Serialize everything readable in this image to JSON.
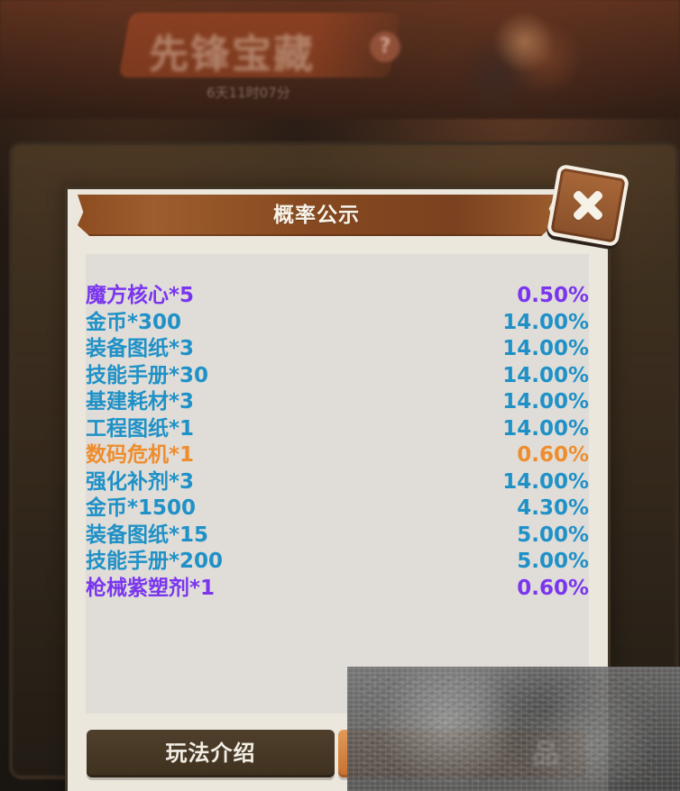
{
  "background": {
    "event_title": "先锋宝藏",
    "help_icon_text": "?",
    "timer": "6天11时07分"
  },
  "dialog": {
    "title": "概率公示",
    "close_icon_name": "close-icon",
    "items": [
      {
        "name": "魔方核心*5",
        "rate": "0.50%",
        "color": "#7a35ef"
      },
      {
        "name": "金币*300",
        "rate": "14.00%",
        "color": "#1f91c7"
      },
      {
        "name": "装备图纸*3",
        "rate": "14.00%",
        "color": "#1f91c7"
      },
      {
        "name": "技能手册*30",
        "rate": "14.00%",
        "color": "#1f91c7"
      },
      {
        "name": "基建耗材*3",
        "rate": "14.00%",
        "color": "#1f91c7"
      },
      {
        "name": "工程图纸*1",
        "rate": "14.00%",
        "color": "#1f91c7"
      },
      {
        "name": "数码危机*1",
        "rate": "0.60%",
        "color": "#ee8d2e"
      },
      {
        "name": "强化补剂*3",
        "rate": "14.00%",
        "color": "#1f91c7"
      },
      {
        "name": "金币*1500",
        "rate": "4.30%",
        "color": "#1f91c7"
      },
      {
        "name": "装备图纸*15",
        "rate": "5.00%",
        "color": "#1f91c7"
      },
      {
        "name": "技能手册*200",
        "rate": "5.00%",
        "color": "#1f91c7"
      },
      {
        "name": "枪械紫塑剂*1",
        "rate": "0.60%",
        "color": "#7a35ef"
      }
    ],
    "buttons": {
      "left_label": "玩法介绍"
    }
  },
  "overlay": {
    "text": "品"
  }
}
